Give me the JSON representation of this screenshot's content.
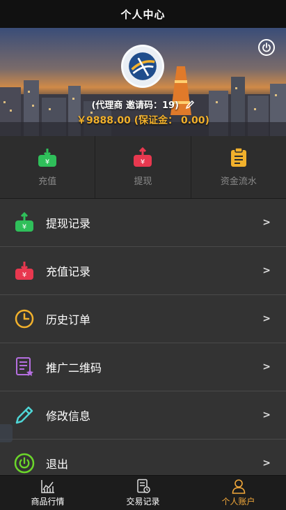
{
  "header": {
    "title": "个人中心"
  },
  "banner": {
    "agent_text": "(代理商 邀请码：19)",
    "balance_text": "￥9888.00 (保证金： 0.00)"
  },
  "quick_actions": [
    {
      "label": "充值",
      "icon": "deposit-icon"
    },
    {
      "label": "提现",
      "icon": "withdraw-icon"
    },
    {
      "label": "资金流水",
      "icon": "clipboard-icon"
    }
  ],
  "menu": [
    {
      "label": "提现记录",
      "icon": "withdraw-record-icon",
      "arrow": ">"
    },
    {
      "label": "充值记录",
      "icon": "deposit-record-icon",
      "arrow": ">"
    },
    {
      "label": "历史订单",
      "icon": "clock-icon",
      "arrow": ">"
    },
    {
      "label": "推广二维码",
      "icon": "qrcode-doc-icon",
      "arrow": ">"
    },
    {
      "label": "修改信息",
      "icon": "edit-pencil-icon",
      "arrow": ">"
    },
    {
      "label": "退出",
      "icon": "power-icon",
      "arrow": ">"
    }
  ],
  "bottom_nav": [
    {
      "label": "商品行情",
      "icon": "chart-icon",
      "active": false
    },
    {
      "label": "交易记录",
      "icon": "document-icon",
      "active": false
    },
    {
      "label": "个人账户",
      "icon": "user-icon",
      "active": true
    }
  ],
  "colors": {
    "accent": "#f2a83a",
    "balance": "#f2b12c",
    "green": "#2fbf5a",
    "red": "#e8384f",
    "orange": "#f2b12c",
    "purple": "#b56fe0",
    "teal": "#4fd6d6",
    "lime": "#6bd62a"
  }
}
